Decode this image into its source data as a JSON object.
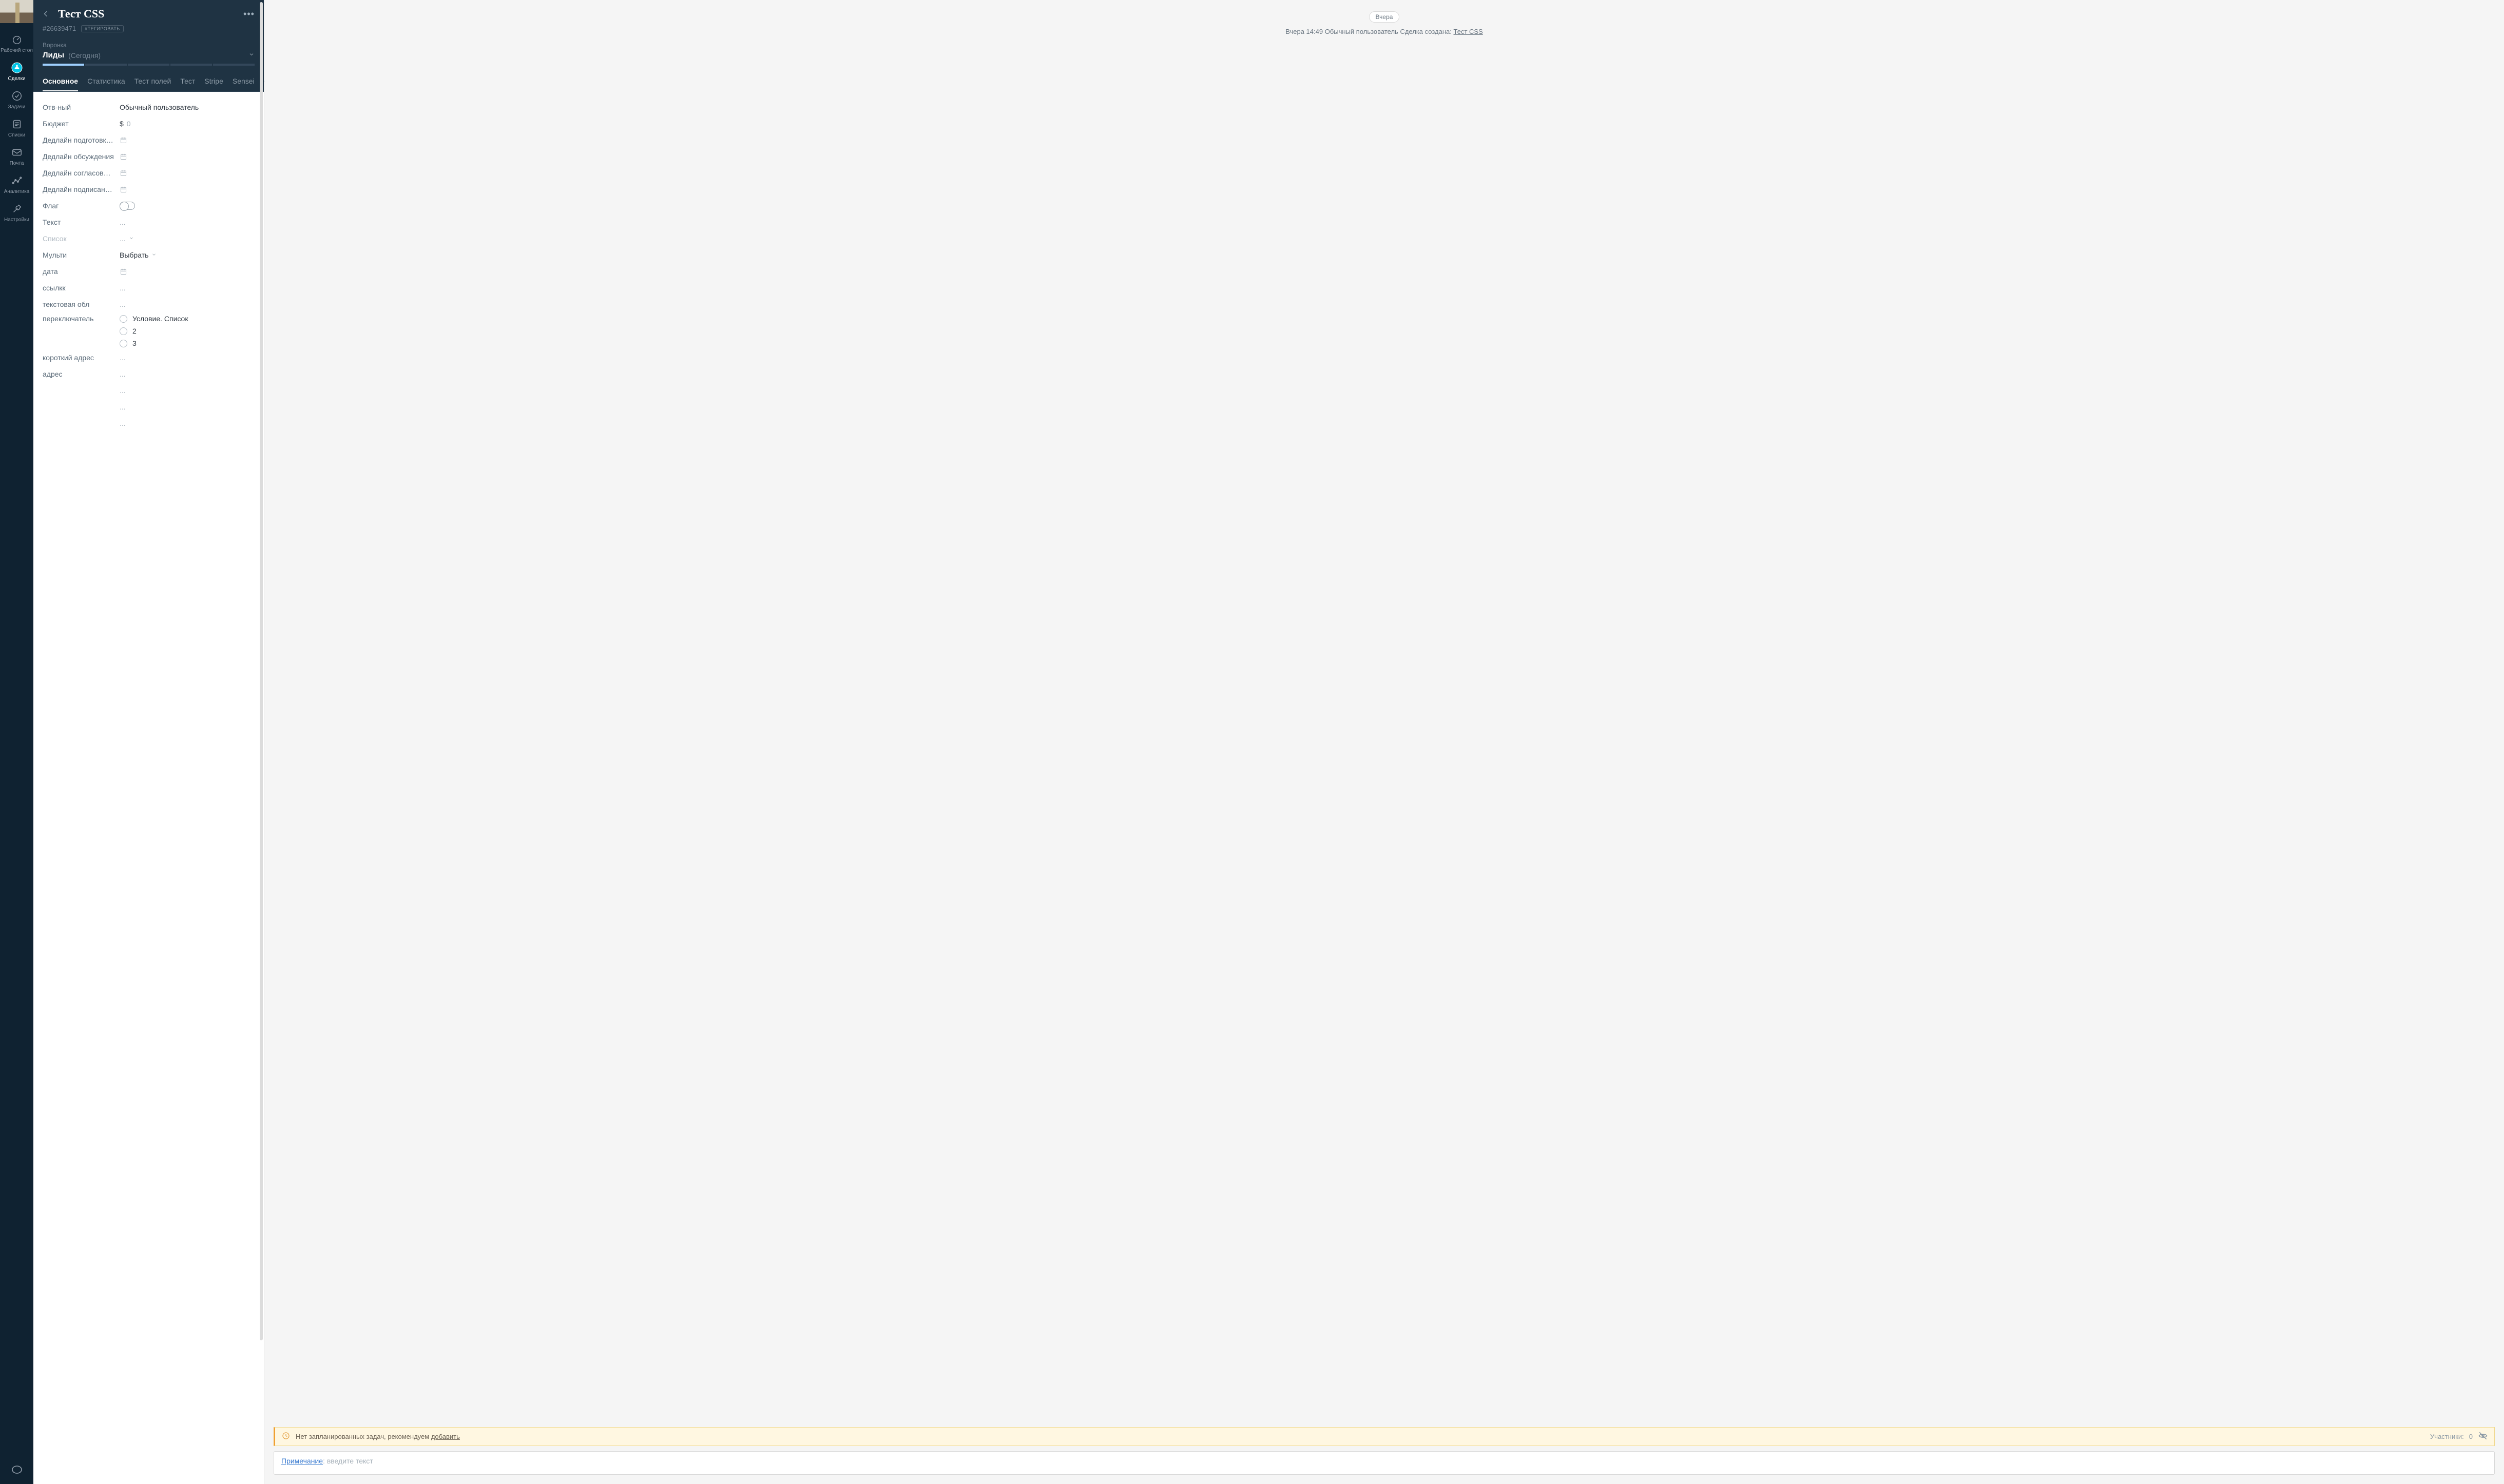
{
  "rail": {
    "items": [
      {
        "label": "Рабочий стол"
      },
      {
        "label": "Сделки"
      },
      {
        "label": "Задачи"
      },
      {
        "label": "Списки"
      },
      {
        "label": "Почта"
      },
      {
        "label": "Аналитика"
      },
      {
        "label": "Настройки"
      }
    ]
  },
  "deal": {
    "title": "Тест CSS",
    "id": "#26639471",
    "tag_button": "#ТЕГИРОВАТЬ",
    "pipeline_label": "Воронка",
    "stage": "Лиды",
    "stage_when": "(Сегодня)",
    "tabs": [
      "Основное",
      "Статистика",
      "Тест полей",
      "Тест",
      "Stripe",
      "Sensei"
    ],
    "fields": {
      "responsible_label": "Отв-ный",
      "responsible_value": "Обычный пользователь",
      "budget_label": "Бюджет",
      "budget_currency": "$",
      "budget_placeholder": "0",
      "deadline_prepare": "Дедлайн подготовки п",
      "deadline_discuss": "Дедлайн обсуждения",
      "deadline_approve": "Дедлайн согласования",
      "deadline_sign": "Дедлайн подписания к",
      "flag": "Флаг",
      "text": "Текст",
      "text_ph": "...",
      "list": "Список",
      "list_ph": "...",
      "multi": "Мульти",
      "multi_ph": "Выбрать",
      "date": "дата",
      "link": "ссылкк",
      "link_ph": "...",
      "textarea": "текстовая обл",
      "textarea_ph": "...",
      "switch": "переключатель",
      "switch_options": [
        "Условие. Список",
        "2",
        "3"
      ],
      "short_address": "короткий адрес",
      "short_address_ph": "...",
      "address": "адрес",
      "address_ph": "..."
    }
  },
  "timeline": {
    "day_separator": "Вчера",
    "event_time": "Вчера 14:49",
    "event_user": "Обычный пользователь",
    "event_text": "Сделка создана:",
    "event_link": "Тест CSS",
    "no_tasks_text": "Нет запланированных задач, рекомендуем ",
    "no_tasks_add": "добавить",
    "participants_label": "Участники:",
    "participants_count": "0",
    "note_type": "Примечание",
    "note_placeholder": ": введите текст"
  }
}
